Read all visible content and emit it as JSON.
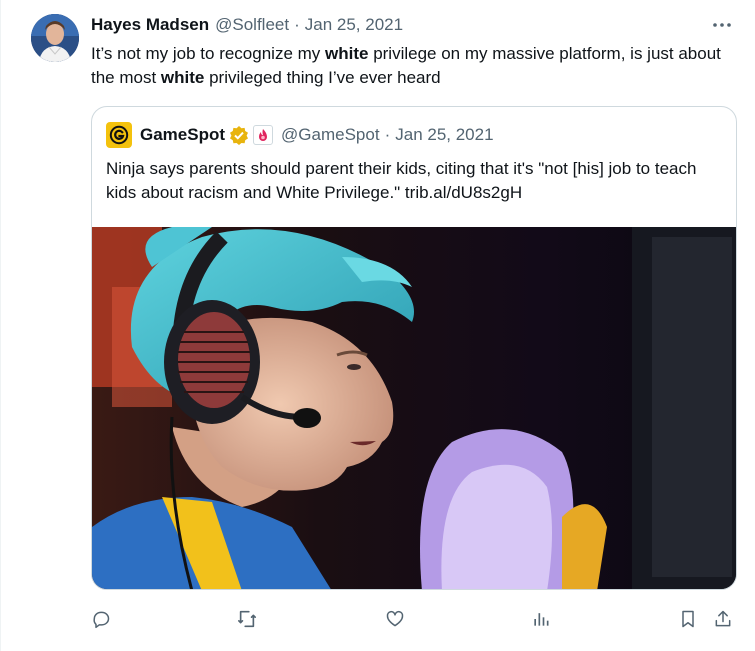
{
  "author": {
    "name": "Hayes Madsen",
    "handle": "@Solfleet",
    "separator": "·",
    "date": "Jan 25, 2021"
  },
  "tweet": {
    "text_1": "It’s not my job to recognize my ",
    "bold_1": "white",
    "text_2": " privilege on my massive platform, is just about the most ",
    "bold_2": "white",
    "text_3": " privileged thing I’ve ever heard"
  },
  "quote": {
    "logo_letter": "G",
    "name": "GameSpot",
    "handle": "@GameSpot",
    "separator": "·",
    "date": "Jan 25, 2021",
    "text": "Ninja says parents should parent their kids, citing that it's \"not [his] job to teach kids about racism and White Privilege.\" trib.al/dU8s2gH"
  },
  "icons": {
    "more": "more-icon",
    "reply": "reply-icon",
    "retweet": "retweet-icon",
    "like": "like-icon",
    "views": "views-icon",
    "bookmark": "bookmark-icon",
    "share": "share-icon",
    "verified": "verified-badge-icon",
    "affiliate": "affiliate-badge-icon"
  },
  "colors": {
    "text": "#0f1419",
    "muted": "#536471",
    "border": "#cfd9de",
    "gamespot_yellow": "#f4c20d",
    "verified_gold": "#e8b40e",
    "hair_teal": "#3bb6c8"
  }
}
